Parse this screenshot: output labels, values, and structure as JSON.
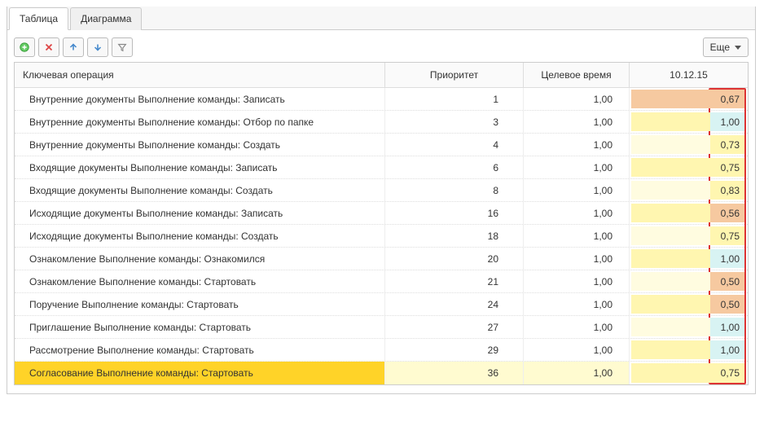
{
  "tabs": {
    "table": "Таблица",
    "chart": "Диаграмма"
  },
  "toolbar": {
    "more": "Еще"
  },
  "headers": {
    "op": "Ключевая операция",
    "prio": "Приоритет",
    "target": "Целевое время",
    "date": "10.12.15"
  },
  "rows": [
    {
      "op": "Внутренние документы Выполнение команды: Записать",
      "prio": "1",
      "target": "1,00",
      "val": "0,67",
      "left": "orange",
      "right": "orange"
    },
    {
      "op": "Внутренние документы Выполнение команды: Отбор по папке",
      "prio": "3",
      "target": "1,00",
      "val": "1,00",
      "left": "yellow",
      "right": "cyan"
    },
    {
      "op": "Внутренние документы Выполнение команды: Создать",
      "prio": "4",
      "target": "1,00",
      "val": "0,73",
      "left": "ly",
      "right": "yellow"
    },
    {
      "op": "Входящие документы Выполнение команды: Записать",
      "prio": "6",
      "target": "1,00",
      "val": "0,75",
      "left": "yellow",
      "right": "yellow"
    },
    {
      "op": "Входящие документы Выполнение команды: Создать",
      "prio": "8",
      "target": "1,00",
      "val": "0,83",
      "left": "ly",
      "right": "yellow"
    },
    {
      "op": "Исходящие документы Выполнение команды: Записать",
      "prio": "16",
      "target": "1,00",
      "val": "0,56",
      "left": "yellow",
      "right": "orange"
    },
    {
      "op": "Исходящие документы Выполнение команды: Создать",
      "prio": "18",
      "target": "1,00",
      "val": "0,75",
      "left": "ly",
      "right": "yellow"
    },
    {
      "op": "Ознакомление Выполнение команды: Ознакомился",
      "prio": "20",
      "target": "1,00",
      "val": "1,00",
      "left": "yellow",
      "right": "cyan"
    },
    {
      "op": "Ознакомление Выполнение команды: Стартовать",
      "prio": "21",
      "target": "1,00",
      "val": "0,50",
      "left": "ly",
      "right": "orange"
    },
    {
      "op": "Поручение Выполнение команды: Стартовать",
      "prio": "24",
      "target": "1,00",
      "val": "0,50",
      "left": "yellow",
      "right": "orange"
    },
    {
      "op": "Приглашение Выполнение команды: Стартовать",
      "prio": "27",
      "target": "1,00",
      "val": "1,00",
      "left": "ly",
      "right": "cyan"
    },
    {
      "op": "Рассмотрение Выполнение команды: Стартовать",
      "prio": "29",
      "target": "1,00",
      "val": "1,00",
      "left": "yellow",
      "right": "cyan"
    },
    {
      "op": "Согласование Выполнение команды: Стартовать",
      "prio": "36",
      "target": "1,00",
      "val": "0,75",
      "left": "yellow",
      "right": "yellow",
      "hl": true
    }
  ]
}
